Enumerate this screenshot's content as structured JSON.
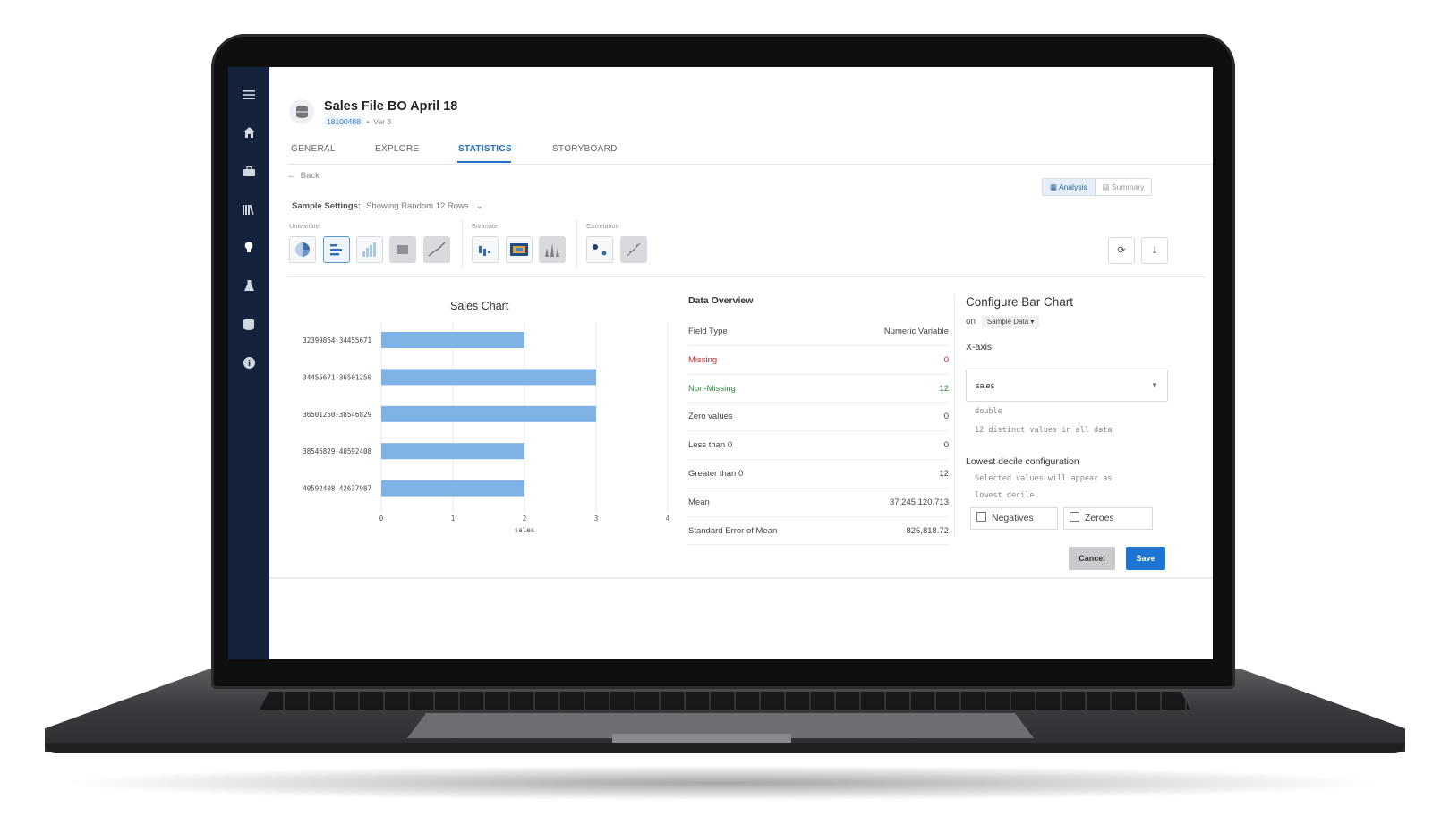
{
  "app": {
    "doc_title": "Sales File BO April 18",
    "doc_id": "18100488",
    "doc_version": "Ver 3"
  },
  "sidebar": {
    "items": [
      "menu-icon",
      "home-icon",
      "briefcase-icon",
      "library-icon",
      "bulb-icon",
      "flask-icon",
      "database-icon",
      "info-icon"
    ],
    "active": "bulb-icon"
  },
  "tabs": [
    {
      "label": "GENERAL"
    },
    {
      "label": "EXPLORE"
    },
    {
      "label": "STATISTICS",
      "active": true
    },
    {
      "label": "STORYBOARD"
    }
  ],
  "toolbar": {
    "back_label": "Back",
    "analysis_label": "Analysis",
    "summary_label": "Summary",
    "sample_settings_label": "Sample Settings:",
    "sample_settings_value": "Showing Random 12 Rows",
    "univariate_label": "Univariate",
    "bivariate_label": "Bivariate",
    "correlation_label": "Correlation"
  },
  "chart_data": {
    "type": "bar",
    "orientation": "horizontal",
    "title": "Sales Chart",
    "categories": [
      "32399864-34455671",
      "34455671-36501250",
      "36501250-38546829",
      "38546829-40592408",
      "40592408-42637987"
    ],
    "values": [
      2,
      3,
      3,
      2,
      2
    ],
    "xlabel": "sales",
    "ylabel": "",
    "xlim": [
      0,
      4
    ],
    "xticks": [
      "0",
      "1",
      "2",
      "3",
      "4"
    ],
    "grid": true,
    "bar_color": "#7fb3e6"
  },
  "overview": {
    "title": "Data Overview",
    "rows": [
      {
        "label": "Field Type",
        "value": "Numeric Variable",
        "tone": "normal"
      },
      {
        "label": "Missing",
        "value": "0",
        "tone": "red"
      },
      {
        "label": "Non-Missing",
        "value": "12",
        "tone": "green"
      },
      {
        "label": "Zero values",
        "value": "0",
        "tone": "normal"
      },
      {
        "label": "Less than 0",
        "value": "0",
        "tone": "normal"
      },
      {
        "label": "Greater than 0",
        "value": "12",
        "tone": "normal"
      },
      {
        "label": "Mean",
        "value": "37,245,120.713",
        "tone": "normal"
      },
      {
        "label": "Standard Error of Mean",
        "value": "825,818.72",
        "tone": "normal"
      }
    ]
  },
  "config": {
    "title": "Configure Bar Chart",
    "on_label": "on",
    "on_value": "Sample Data",
    "xaxis_label": "X-axis",
    "xaxis_value": "sales",
    "type_note": "double",
    "distinct_note": "12 distinct values in all data",
    "lowest_title": "Lowest decile configuration",
    "lowest_note_1": "Selected values will appear as",
    "lowest_note_2": "lowest decile",
    "negatives_label": "Negatives",
    "zeroes_label": "Zeroes"
  },
  "actions": {
    "cancel_label": "Cancel",
    "save_label": "Save"
  },
  "colors": {
    "sidebar": "#14233b",
    "accent": "#1e74d2",
    "missing": "#c62828",
    "non_missing": "#2e8b3d"
  }
}
